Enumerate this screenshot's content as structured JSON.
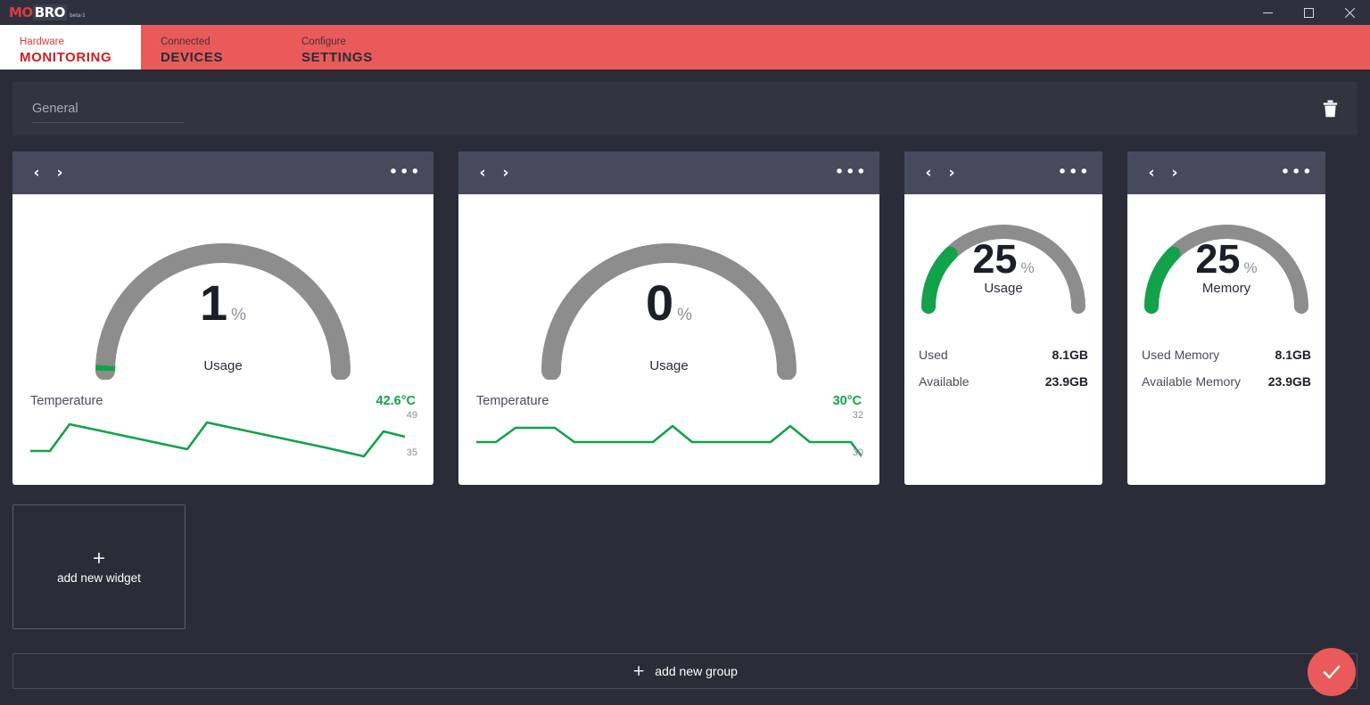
{
  "titlebar": {
    "logo_part1": "MO",
    "logo_part2": "BRO",
    "logo_beta": "beta-1",
    "minimize": "minimize-icon",
    "maximize": "maximize-icon",
    "close": "close-icon"
  },
  "tabs": [
    {
      "sub": "Hardware",
      "main": "MONITORING",
      "active": true
    },
    {
      "sub": "Connected",
      "main": "DEVICES",
      "active": false
    },
    {
      "sub": "Configure",
      "main": "SETTINGS",
      "active": false
    }
  ],
  "group": {
    "name_value": "General",
    "name_placeholder": "General",
    "delete_icon": "trash-icon"
  },
  "widget_nav": {
    "prev": "‹",
    "next": "›",
    "more": "•••"
  },
  "widgets": [
    {
      "type": "gauge-sparkline",
      "gauge": {
        "value": "1",
        "unit": "%",
        "label": "Usage",
        "percent": 1,
        "arc_color": "#12a24a",
        "track_color": "#8d8d8d"
      },
      "sparkline": {
        "label": "Temperature",
        "value": "42.6°C",
        "max_label": "49",
        "min_label": "35",
        "series": [
          37,
          37,
          48,
          46,
          44,
          42,
          40,
          40,
          48,
          46,
          44,
          42,
          40,
          38,
          36,
          35,
          35,
          44,
          43
        ]
      }
    },
    {
      "type": "gauge-sparkline",
      "gauge": {
        "value": "0",
        "unit": "%",
        "label": "Usage",
        "percent": 0,
        "arc_color": "#12a24a",
        "track_color": "#8d8d8d"
      },
      "sparkline": {
        "label": "Temperature",
        "value": "30°C",
        "max_label": "32",
        "min_label": "30",
        "series": [
          30.6,
          30.6,
          31.6,
          31.6,
          31.6,
          30.6,
          30.6,
          30.6,
          30.6,
          32,
          30.6,
          30.6,
          30.6,
          32,
          30.8,
          30.6,
          30.6,
          30
        ]
      }
    },
    {
      "type": "gauge-list",
      "gauge": {
        "value": "25",
        "unit": "%",
        "label": "Usage",
        "percent": 25,
        "arc_color": "#12a24a",
        "track_color": "#8d8d8d"
      },
      "rows": [
        {
          "key": "Used",
          "value": "8.1GB"
        },
        {
          "key": "Available",
          "value": "23.9GB"
        }
      ]
    },
    {
      "type": "gauge-list",
      "gauge": {
        "value": "25",
        "unit": "%",
        "label": "Memory",
        "percent": 25,
        "arc_color": "#12a24a",
        "track_color": "#8d8d8d"
      },
      "rows": [
        {
          "key": "Used Memory",
          "value": "8.1GB"
        },
        {
          "key": "Available Memory",
          "value": "23.9GB"
        }
      ]
    }
  ],
  "add_widget": {
    "plus": "+",
    "label": "add new widget"
  },
  "add_group": {
    "plus": "+",
    "label": "add new group"
  },
  "fab": {
    "icon": "check-icon"
  },
  "colors": {
    "background": "#2b2c38",
    "accent_red": "#ea5a5a",
    "brand_red": "#cf1d24",
    "widget_header": "#474a5c",
    "green": "#12a24a"
  }
}
